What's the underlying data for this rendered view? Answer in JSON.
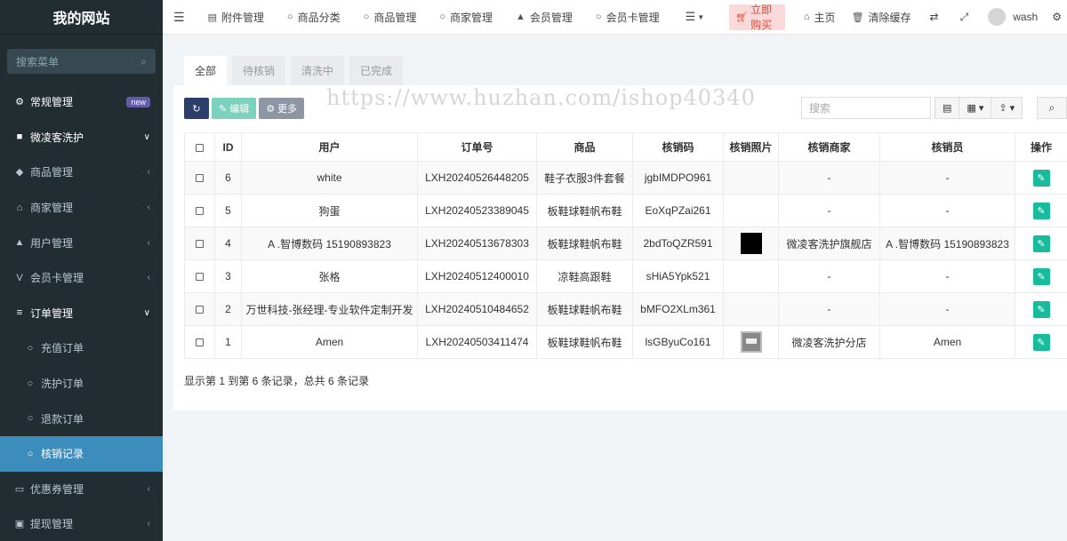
{
  "site": {
    "title": "我的网站"
  },
  "sidebar": {
    "search_placeholder": "搜索菜单",
    "items": [
      {
        "label": "常规管理",
        "icon": "cogs-icon",
        "level": "top",
        "badge": "new"
      },
      {
        "label": "微凌客洗护",
        "icon": "folder-open-icon",
        "level": "top",
        "chevron": "down"
      },
      {
        "label": "商品管理",
        "icon": "cube-icon",
        "level": "sub",
        "chevron": "left"
      },
      {
        "label": "商家管理",
        "icon": "bank-icon",
        "level": "sub",
        "chevron": "left"
      },
      {
        "label": "用户管理",
        "icon": "user-icon",
        "level": "sub",
        "chevron": "left"
      },
      {
        "label": "会员卡管理",
        "icon": "vimeo-icon",
        "level": "sub",
        "chevron": "left"
      },
      {
        "label": "订单管理",
        "icon": "list-icon",
        "level": "sub-open",
        "chevron": "down"
      },
      {
        "label": "充值订单",
        "icon": "circle-icon",
        "level": "subsub"
      },
      {
        "label": "洗护订单",
        "icon": "circle-icon",
        "level": "subsub"
      },
      {
        "label": "退款订单",
        "icon": "circle-icon",
        "level": "subsub"
      },
      {
        "label": "核销记录",
        "icon": "circle-icon",
        "level": "subsub",
        "active": true
      },
      {
        "label": "优惠券管理",
        "icon": "ticket-icon",
        "level": "sub",
        "chevron": "left"
      },
      {
        "label": "提现管理",
        "icon": "money-icon",
        "level": "sub",
        "chevron": "left"
      }
    ]
  },
  "topbar": {
    "items": [
      {
        "label": "附件管理",
        "icon": "file-image-icon"
      },
      {
        "label": "商品分类",
        "icon": "circle-icon"
      },
      {
        "label": "商品管理",
        "icon": "circle-icon"
      },
      {
        "label": "商家管理",
        "icon": "circle-icon"
      },
      {
        "label": "会员管理",
        "icon": "user-icon"
      },
      {
        "label": "会员卡管理",
        "icon": "circle-icon"
      }
    ],
    "buy_label": "立即购买",
    "home_label": "主页",
    "clear_cache_label": "清除缓存",
    "username": "wash"
  },
  "tabs": [
    "全部",
    "待核销",
    "清洗中",
    "已完成"
  ],
  "toolbar": {
    "edit_label": "编辑",
    "more_label": "更多",
    "search_placeholder": "搜索",
    "watermark_url": "https://www.huzhan.com/ishop40340"
  },
  "table": {
    "columns": [
      "ID",
      "用户",
      "订单号",
      "商品",
      "核销码",
      "核销照片",
      "核销商家",
      "核销员",
      "操作"
    ],
    "rows": [
      {
        "id": "6",
        "user": "white",
        "order_no": "LXH20240526448205",
        "product": "鞋子衣服3件套餐",
        "code": "jgbIMDPO961",
        "photo": "",
        "merchant": "-",
        "staff": "-"
      },
      {
        "id": "5",
        "user": "狗蛋",
        "order_no": "LXH20240523389045",
        "product": "板鞋球鞋帆布鞋",
        "code": "EoXqPZai261",
        "photo": "",
        "merchant": "-",
        "staff": "-"
      },
      {
        "id": "4",
        "user": "A .智博数码 15190893823",
        "order_no": "LXH20240513678303",
        "product": "板鞋球鞋帆布鞋",
        "code": "2bdToQZR591",
        "photo": "black",
        "merchant": "微凌客洗护旗舰店",
        "staff": "A .智博数码 15190893823"
      },
      {
        "id": "3",
        "user": "张格",
        "order_no": "LXH20240512400010",
        "product": "凉鞋高跟鞋",
        "code": "sHiA5Ypk521",
        "photo": "",
        "merchant": "-",
        "staff": "-"
      },
      {
        "id": "2",
        "user": "万世科技-张经理-专业软件定制开发",
        "order_no": "LXH20240510484652",
        "product": "板鞋球鞋帆布鞋",
        "code": "bMFO2XLm361",
        "photo": "",
        "merchant": "-",
        "staff": "-"
      },
      {
        "id": "1",
        "user": "Amen",
        "order_no": "LXH20240503411474",
        "product": "板鞋球鞋帆布鞋",
        "code": "lsGByuCo161",
        "photo": "thumb",
        "merchant": "微凌客洗护分店",
        "staff": "Amen"
      }
    ]
  },
  "pagination_info": "显示第 1 到第 6 条记录，总共 6 条记录"
}
